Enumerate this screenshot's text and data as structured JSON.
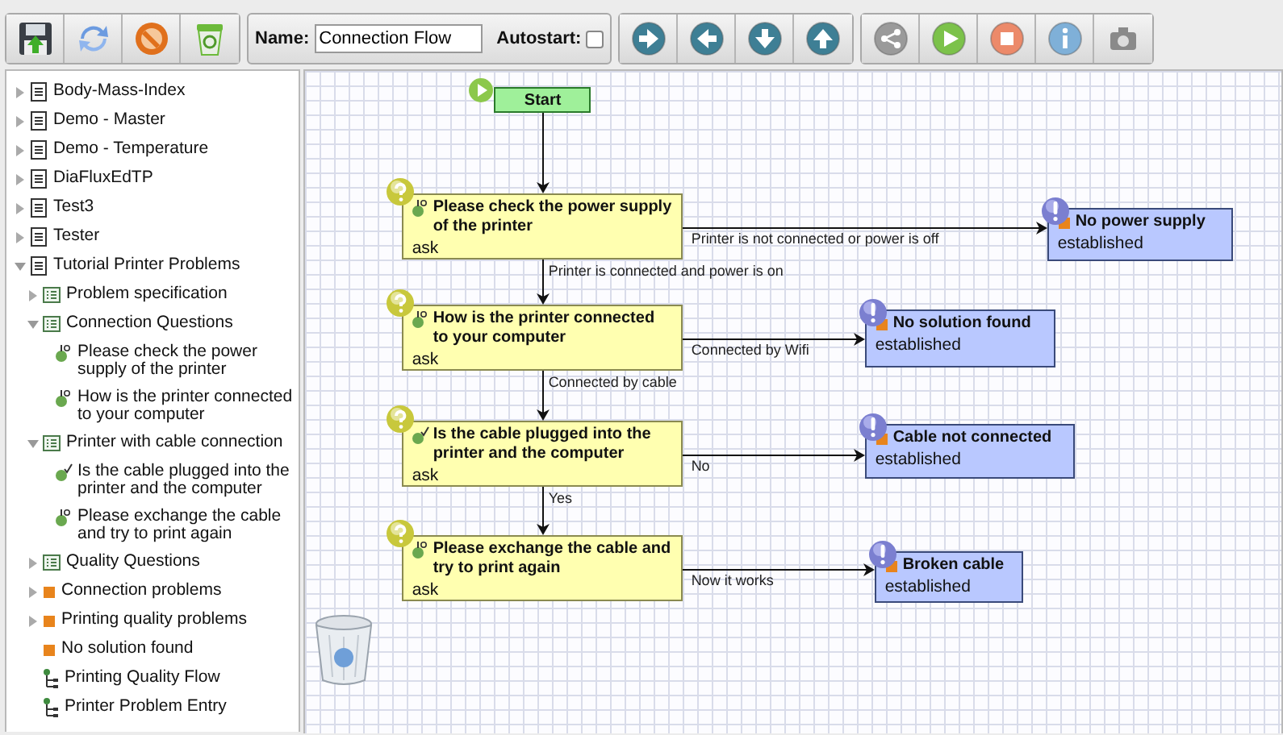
{
  "toolbar": {
    "name_field": {
      "label": "Name:",
      "value": "Connection Flow"
    },
    "autostart": {
      "label": "Autostart:",
      "checked": false
    }
  },
  "sidebar": {
    "items": [
      {
        "label": "Body-Mass-Index",
        "kind": "document",
        "expanded": false
      },
      {
        "label": "Demo - Master",
        "kind": "document",
        "expanded": false
      },
      {
        "label": "Demo - Temperature",
        "kind": "document",
        "expanded": false
      },
      {
        "label": "DiaFluxEdTP",
        "kind": "document",
        "expanded": false
      },
      {
        "label": "Test3",
        "kind": "document",
        "expanded": false
      },
      {
        "label": "Tester",
        "kind": "document",
        "expanded": false
      },
      {
        "label": "Tutorial Printer Problems",
        "kind": "document",
        "expanded": true,
        "children": [
          {
            "label": "Problem specification",
            "kind": "questionnaire",
            "expanded": false
          },
          {
            "label": "Connection Questions",
            "kind": "questionnaire",
            "expanded": true,
            "children": [
              {
                "label": "Please check the power supply of the printer",
                "kind": "choice_question"
              },
              {
                "label": "How is the printer connected to your computer",
                "kind": "choice_question"
              }
            ]
          },
          {
            "label": "Printer with cable connection",
            "kind": "questionnaire",
            "expanded": true,
            "children": [
              {
                "label": "Is the cable plugged into the printer and the computer",
                "kind": "yes_no_question"
              },
              {
                "label": "Please exchange the cable and try to print again",
                "kind": "choice_question"
              }
            ]
          },
          {
            "label": "Quality Questions",
            "kind": "questionnaire",
            "expanded": false
          },
          {
            "label": "Connection problems",
            "kind": "solution",
            "expanded": false
          },
          {
            "label": "Printing quality problems",
            "kind": "solution",
            "expanded": false
          },
          {
            "label": "No solution found",
            "kind": "solution"
          },
          {
            "label": "Printing Quality Flow",
            "kind": "flow"
          },
          {
            "label": "Printer Problem Entry",
            "kind": "flow"
          }
        ]
      }
    ]
  },
  "flow": {
    "nodes": [
      {
        "kind": "start",
        "title": "Start"
      },
      {
        "kind": "choice_question",
        "title": "Please check the power supply of the printer",
        "type_label": "ask"
      },
      {
        "kind": "choice_question",
        "title": "How is the printer connected to your computer",
        "type_label": "ask"
      },
      {
        "kind": "yes_no_question",
        "title": "Is the cable plugged into the printer and the computer",
        "type_label": "ask"
      },
      {
        "kind": "choice_question",
        "title": "Please exchange the cable and try to print again",
        "type_label": "ask"
      },
      {
        "kind": "solution",
        "title": "No power supply",
        "type_label": "established"
      },
      {
        "kind": "solution",
        "title": "No solution found",
        "type_label": "established"
      },
      {
        "kind": "solution",
        "title": "Cable not connected",
        "type_label": "established"
      },
      {
        "kind": "solution",
        "title": "Broken cable",
        "type_label": "established"
      }
    ],
    "edges": [
      {
        "kind": "vertical"
      },
      {
        "kind": "vertical",
        "label": "Printer is connected and power is on"
      },
      {
        "kind": "horizontal",
        "label": "Printer is not connected or power is off"
      },
      {
        "kind": "vertical",
        "label": "Connected by cable"
      },
      {
        "kind": "horizontal",
        "label": "Connected by Wifi"
      },
      {
        "kind": "vertical",
        "label": "Yes"
      },
      {
        "kind": "horizontal",
        "label": "No"
      },
      {
        "kind": "horizontal",
        "label": "Now it works"
      }
    ]
  }
}
